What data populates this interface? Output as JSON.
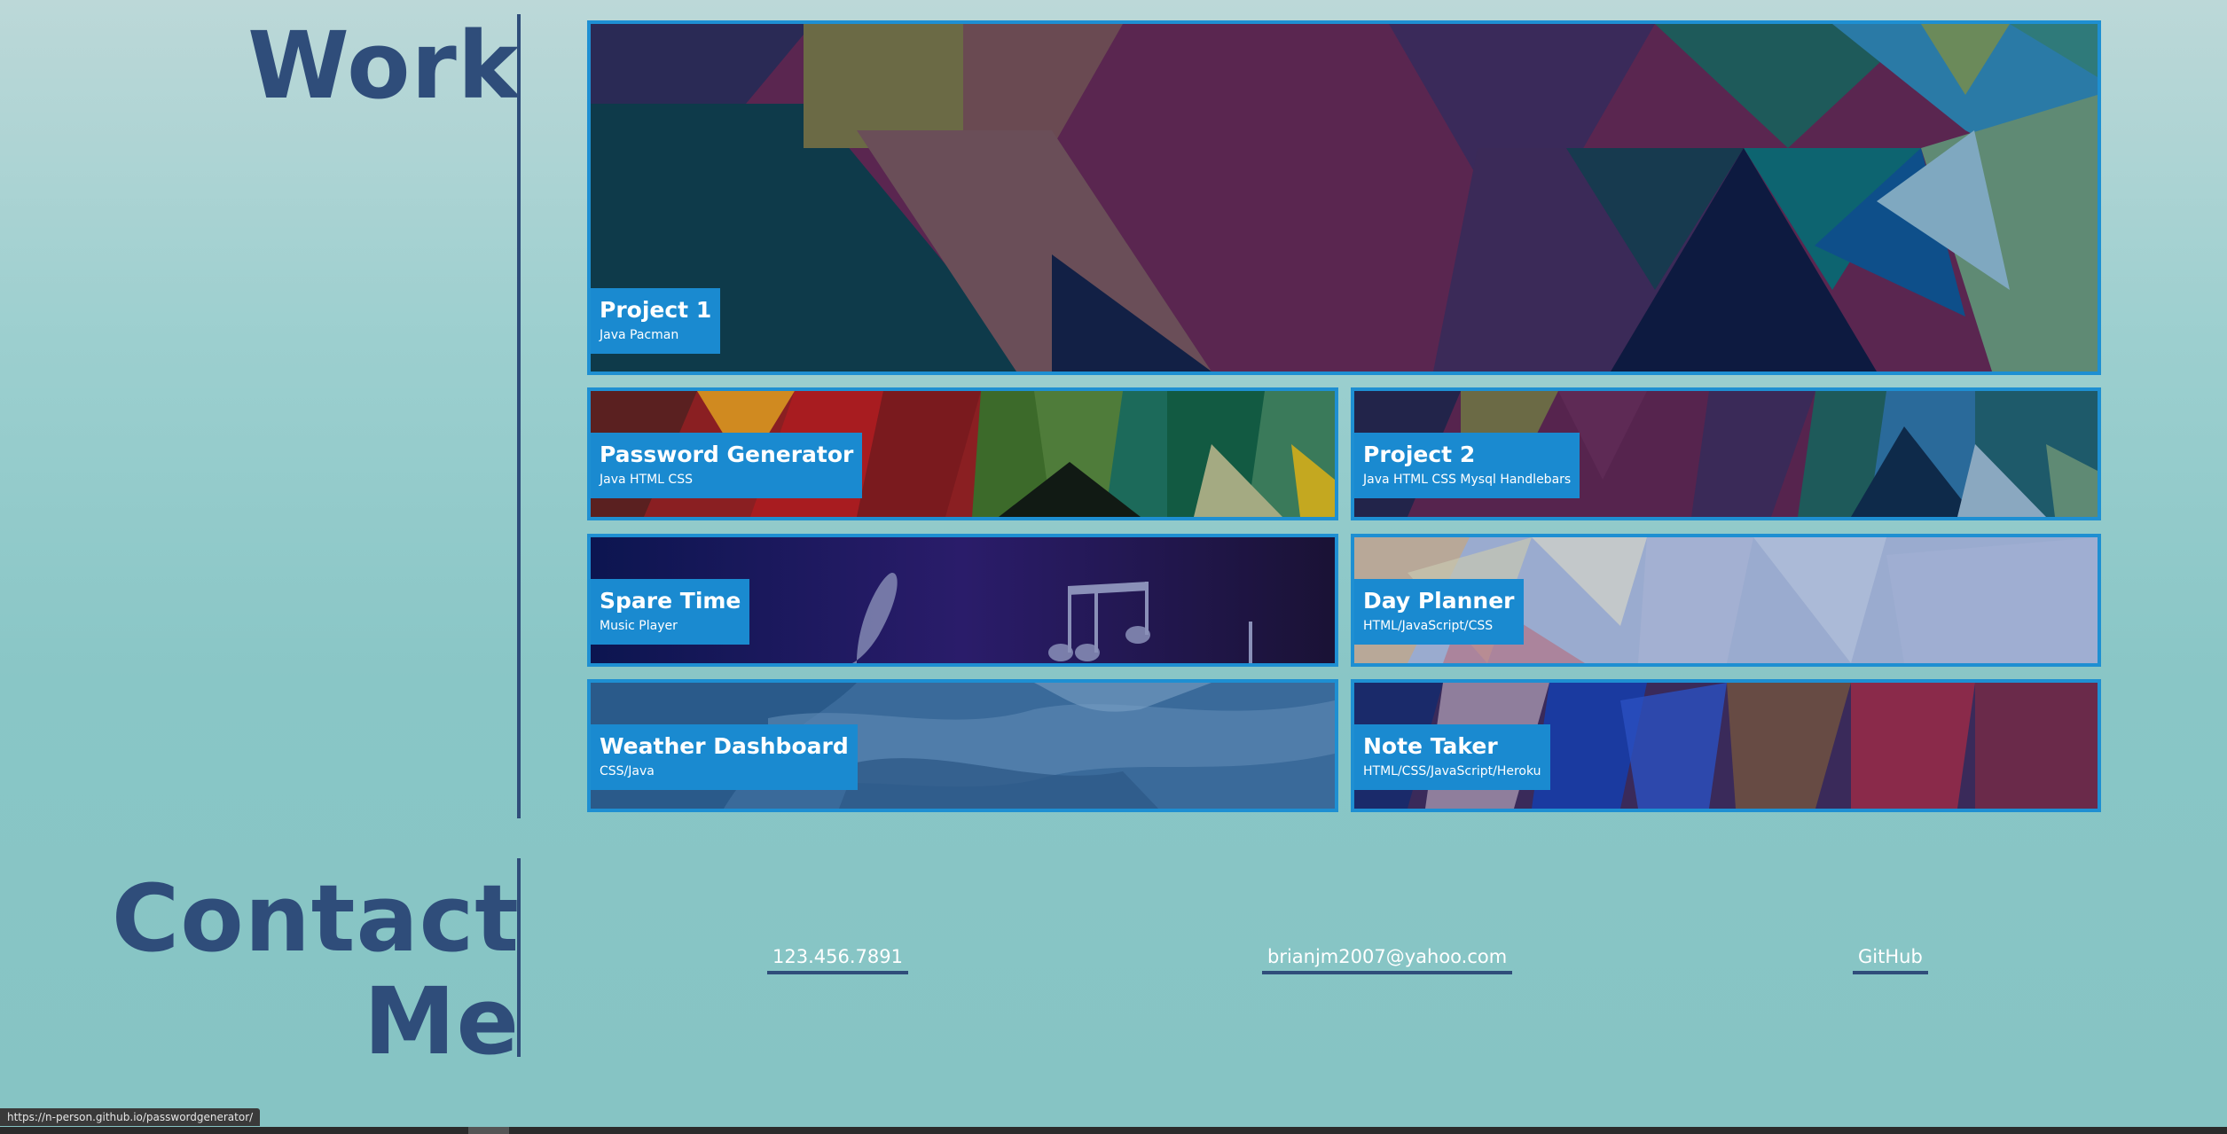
{
  "work": {
    "title": "Work",
    "projects": [
      {
        "name": "Project 1",
        "tech": "Java Pacman"
      },
      {
        "name": "Password Generator",
        "tech": "Java HTML CSS"
      },
      {
        "name": "Project 2",
        "tech": "Java HTML CSS Mysql Handlebars"
      },
      {
        "name": "Spare Time",
        "tech": "Music Player"
      },
      {
        "name": "Day Planner",
        "tech": "HTML/JavaScript/CSS"
      },
      {
        "name": "Weather Dashboard",
        "tech": "CSS/Java"
      },
      {
        "name": "Note Taker",
        "tech": "HTML/CSS/JavaScript/Heroku"
      }
    ]
  },
  "contact": {
    "title_line1": "Contact",
    "title_line2": "Me",
    "phone": "123.456.7891",
    "email": "brianjm2007@yahoo.com",
    "github": "GitHub"
  },
  "status_url": "https://n-person.github.io/passwordgenerator/",
  "colors": {
    "heading": "#2f4d7a",
    "card_border": "#1e8fd2",
    "label_bg": "#1a8ad0",
    "background_top": "#bcd8d8",
    "background_bottom": "#86c4c4"
  }
}
